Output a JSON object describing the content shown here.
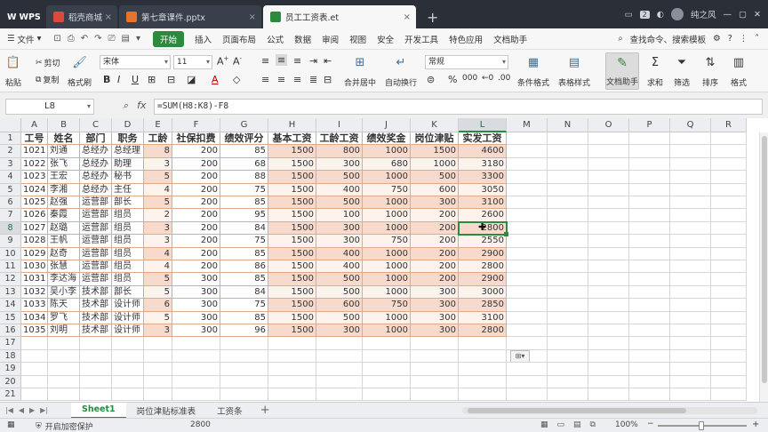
{
  "titlebar": {
    "tabs": [
      {
        "label": "WPS",
        "kind": "app"
      },
      {
        "label": "稻壳商城",
        "icon_color": "#d94a3a"
      },
      {
        "label": "第七章课件.pptx",
        "icon_color": "#e7742c"
      },
      {
        "label": "员工工资表.et",
        "icon_color": "#2b8a3e",
        "active": true
      }
    ],
    "new_tab": "+",
    "badge": "2",
    "user": "纯之风"
  },
  "menubar": {
    "file": "文件",
    "start": "开始",
    "items": [
      "插入",
      "页面布局",
      "公式",
      "数据",
      "审阅",
      "视图",
      "安全",
      "开发工具",
      "特色应用",
      "文档助手"
    ],
    "search": "查找命令、搜索模板"
  },
  "ribbon": {
    "paste": "粘贴",
    "cut": "剪切",
    "copy": "复制",
    "format_painter": "格式刷",
    "font_name": "宋体",
    "font_size": "11",
    "merge": "合并居中",
    "wrap": "自动换行",
    "number_format": "常规",
    "cond_format": "条件格式",
    "table_style": "表格样式",
    "doc_helper": "文档助手",
    "sum": "求和",
    "filter": "筛选",
    "sort": "排序",
    "format": "格式"
  },
  "formula_bar": {
    "name_box": "L8",
    "fx": "fx",
    "formula": "=SUM(H8:K8)-F8"
  },
  "columns": [
    "A",
    "B",
    "C",
    "D",
    "E",
    "F",
    "G",
    "H",
    "I",
    "J",
    "K",
    "L",
    "M",
    "N",
    "O",
    "P",
    "Q",
    "R"
  ],
  "selected": {
    "col": "L",
    "row": 8
  },
  "table": {
    "headers": [
      "工号",
      "姓名",
      "部门",
      "职务",
      "工龄",
      "社保扣费",
      "绩效评分",
      "基本工资",
      "工龄工资",
      "绩效奖金",
      "岗位津贴",
      "实发工资"
    ],
    "rows": [
      [
        "1021",
        "刘通",
        "总经办",
        "总经理",
        "8",
        "200",
        "85",
        "1500",
        "800",
        "1000",
        "1500",
        "4600"
      ],
      [
        "1022",
        "张飞",
        "总经办",
        "助理",
        "3",
        "200",
        "68",
        "1500",
        "300",
        "680",
        "1000",
        "3180"
      ],
      [
        "1023",
        "王宏",
        "总经办",
        "秘书",
        "5",
        "200",
        "88",
        "1500",
        "500",
        "1000",
        "500",
        "3300"
      ],
      [
        "1024",
        "李湘",
        "总经办",
        "主任",
        "4",
        "200",
        "75",
        "1500",
        "400",
        "750",
        "600",
        "3050"
      ],
      [
        "1025",
        "赵强",
        "运营部",
        "部长",
        "5",
        "200",
        "85",
        "1500",
        "500",
        "1000",
        "300",
        "3100"
      ],
      [
        "1026",
        "秦霞",
        "运营部",
        "组员",
        "2",
        "200",
        "95",
        "1500",
        "100",
        "1000",
        "200",
        "2600"
      ],
      [
        "1027",
        "赵璐",
        "运营部",
        "组员",
        "3",
        "200",
        "84",
        "1500",
        "300",
        "1000",
        "200",
        "2800"
      ],
      [
        "1028",
        "王帆",
        "运营部",
        "组员",
        "3",
        "200",
        "75",
        "1500",
        "300",
        "750",
        "200",
        "2550"
      ],
      [
        "1029",
        "赵奇",
        "运营部",
        "组员",
        "4",
        "200",
        "85",
        "1500",
        "400",
        "1000",
        "200",
        "2900"
      ],
      [
        "1030",
        "张慧",
        "运营部",
        "组员",
        "4",
        "200",
        "86",
        "1500",
        "400",
        "1000",
        "200",
        "2800"
      ],
      [
        "1031",
        "李达海",
        "运营部",
        "组员",
        "5",
        "300",
        "85",
        "1500",
        "500",
        "1000",
        "200",
        "2900"
      ],
      [
        "1032",
        "吴小李",
        "技术部",
        "部长",
        "5",
        "300",
        "84",
        "1500",
        "500",
        "1000",
        "300",
        "3000"
      ],
      [
        "1033",
        "陈天",
        "技术部",
        "设计师",
        "6",
        "300",
        "75",
        "1500",
        "600",
        "750",
        "300",
        "2850"
      ],
      [
        "1034",
        "罗飞",
        "技术部",
        "设计师",
        "5",
        "300",
        "85",
        "1500",
        "500",
        "1000",
        "300",
        "3100"
      ],
      [
        "1035",
        "刘明",
        "技术部",
        "设计师",
        "3",
        "300",
        "96",
        "1500",
        "300",
        "1000",
        "300",
        "2800"
      ]
    ]
  },
  "sheets": [
    "Sheet1",
    "岗位津贴标准表",
    "工资条"
  ],
  "statusbar": {
    "protect": "开启加密保护",
    "sum": "2800",
    "zoom": "100%",
    "plus": "+"
  },
  "colors": {
    "accent": "#2b8a3e",
    "tint": "#f8dacd",
    "titlebar": "#2a2f38"
  }
}
